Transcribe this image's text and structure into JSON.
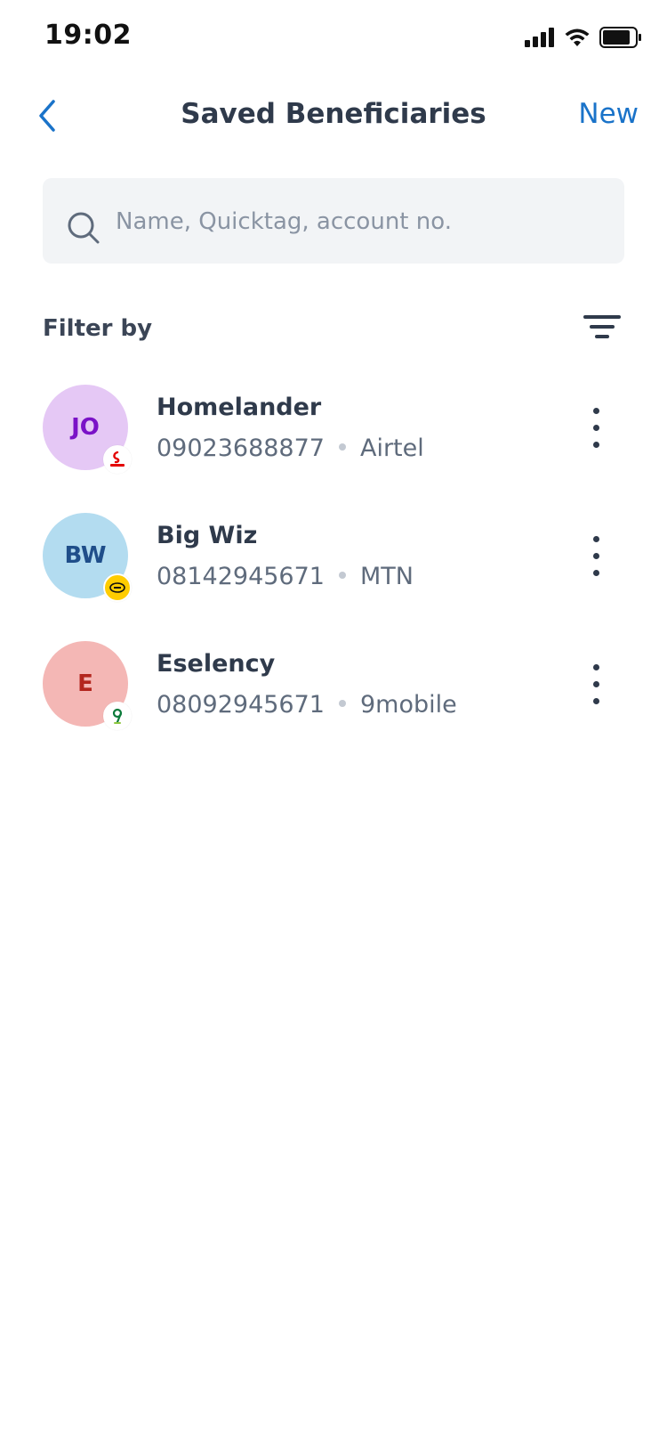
{
  "status_bar": {
    "time": "19:02"
  },
  "header": {
    "title": "Saved Beneficiaries",
    "new_label": "New"
  },
  "search": {
    "placeholder": "Name, Quicktag, account no."
  },
  "filter": {
    "label": "Filter by"
  },
  "beneficiaries": [
    {
      "initials": "JO",
      "name": "Homelander",
      "phone": "09023688877",
      "network": "Airtel",
      "avatar_bg": "#e5c8f5",
      "avatar_fg": "#7a12c7",
      "badge_icon": "airtel-logo-icon"
    },
    {
      "initials": "BW",
      "name": "Big Wiz",
      "phone": "08142945671",
      "network": "MTN",
      "avatar_bg": "#b3dcf0",
      "avatar_fg": "#1f4e8a",
      "badge_icon": "mtn-logo-icon"
    },
    {
      "initials": "E",
      "name": "Eselency",
      "phone": "08092945671",
      "network": "9mobile",
      "avatar_bg": "#f4b7b5",
      "avatar_fg": "#b3261e",
      "badge_icon": "9mobile-logo-icon"
    }
  ],
  "colors": {
    "accent": "#1a73c9",
    "text_primary": "#2f3a4b",
    "text_secondary": "#5f6b7c",
    "search_bg": "#f2f4f6"
  }
}
